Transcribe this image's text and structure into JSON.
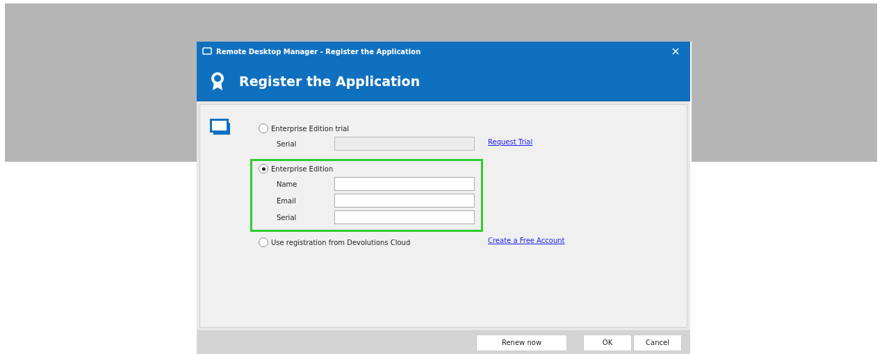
{
  "window": {
    "title": "Remote Desktop Manager - Register the Application"
  },
  "header": {
    "title": "Register the Application"
  },
  "options": [
    {
      "label": "Enterprise Edition trial",
      "selected": false,
      "highlighted": false,
      "fields": [
        {
          "label": "Serial",
          "disabled": true
        }
      ],
      "link": "Request Trial"
    },
    {
      "label": "Enterprise Edition",
      "selected": true,
      "highlighted": true,
      "fields": [
        {
          "label": "Name",
          "disabled": false
        },
        {
          "label": "Email",
          "disabled": false
        },
        {
          "label": "Serial",
          "disabled": false
        }
      ]
    },
    {
      "label": "Use registration from Devolutions Cloud",
      "selected": false,
      "highlighted": false,
      "link": "Create a Free Account"
    }
  ],
  "buttons": [
    {
      "label": "Renew now",
      "kind": "wide"
    },
    {
      "label": "OK",
      "kind": "normal"
    },
    {
      "label": "Cancel",
      "kind": "normal"
    }
  ]
}
